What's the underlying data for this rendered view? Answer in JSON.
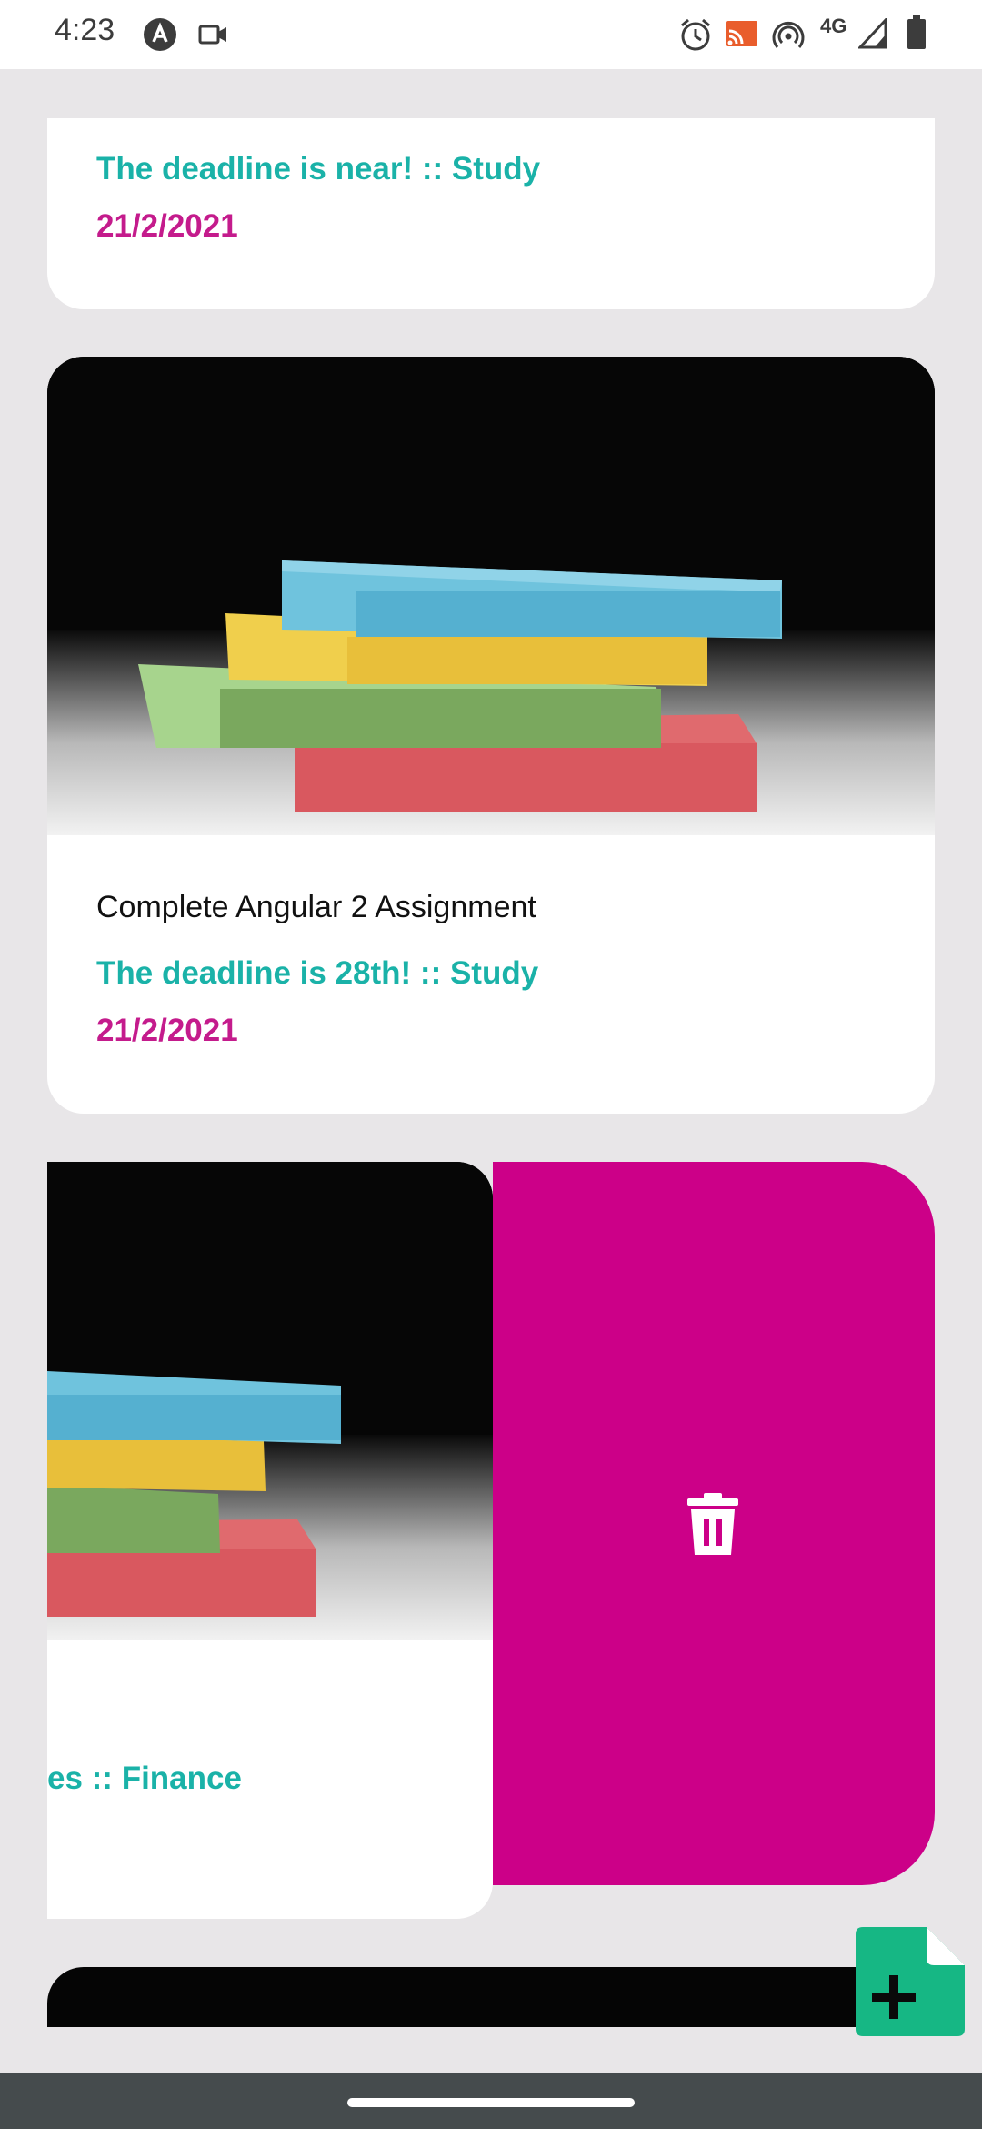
{
  "status_bar": {
    "time": "4:23",
    "network": "4G",
    "icons": [
      "app-logo-icon",
      "video-camera-icon",
      "alarm-icon",
      "cast-icon",
      "hotspot-icon",
      "signal-icon",
      "battery-icon"
    ]
  },
  "cards": [
    {
      "subtitle": "The deadline is near! :: Study",
      "date": "21/2/2021"
    },
    {
      "title": "Complete Angular 2 Assignment",
      "subtitle": "The deadline is 28th! :: Study",
      "date": "21/2/2021"
    },
    {
      "subtitle": "es :: Finance"
    }
  ],
  "swipe_action": {
    "icon": "trash-icon",
    "color": "#cc0088"
  },
  "fab": {
    "icon": "add-note-icon",
    "color": "#16b784"
  },
  "colors": {
    "subtitle": "#1ab2a8",
    "date": "#c41b8c",
    "background": "#e8e6e8"
  }
}
